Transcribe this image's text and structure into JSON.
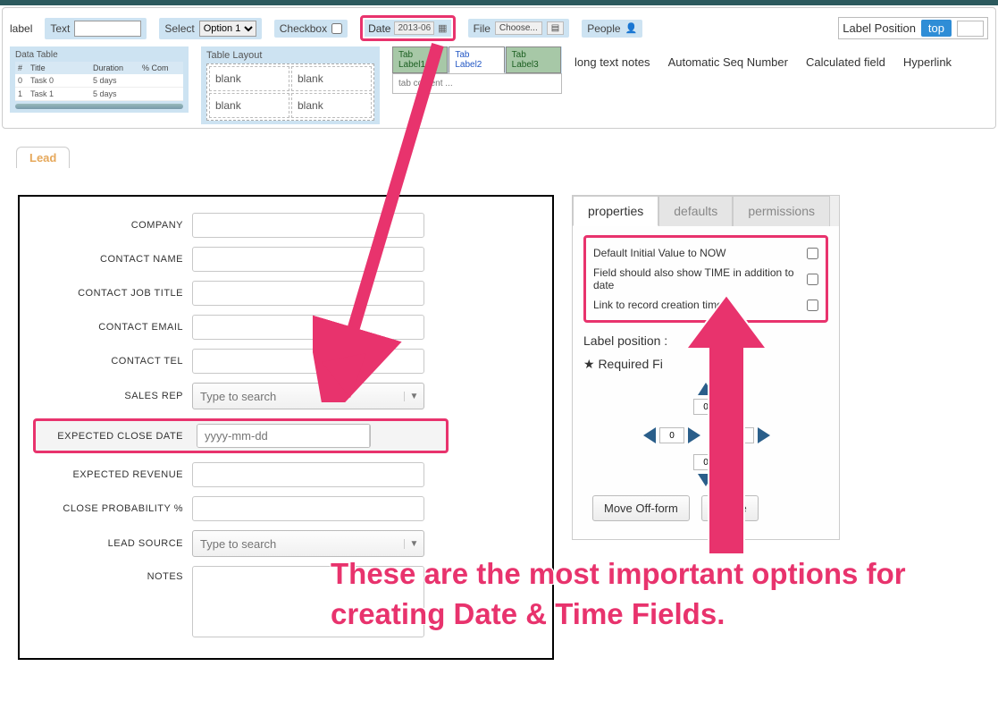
{
  "palette": {
    "label": "label",
    "text": "Text",
    "select": "Select",
    "select_option": "Option 1",
    "checkbox": "Checkbox",
    "date": "Date",
    "date_value": "2013-06",
    "file": "File",
    "file_button": "Choose...",
    "people": "People",
    "label_position": "Label Position",
    "label_position_value": "top"
  },
  "palette2": {
    "data_table": "Data Table",
    "dt_cols": {
      "num": "#",
      "title": "Title",
      "duration": "Duration",
      "pct": "% Com"
    },
    "dt_rows": [
      {
        "n": "0",
        "title": "Task 0",
        "dur": "5 days",
        "pct": ""
      },
      {
        "n": "1",
        "title": "Task 1",
        "dur": "5 days",
        "pct": ""
      }
    ],
    "table_layout": "Table Layout",
    "blank": "blank",
    "tabs": [
      "Tab Label1",
      "Tab Label2",
      "Tab Label3"
    ],
    "tab_content": "tab content ...",
    "links": [
      "long text notes",
      "Automatic Seq Number",
      "Calculated field",
      "Hyperlink"
    ]
  },
  "form": {
    "tab": "Lead",
    "fields": {
      "company": "COMPANY",
      "contact_name": "CONTACT NAME",
      "contact_job": "CONTACT JOB TITLE",
      "contact_email": "CONTACT EMAIL",
      "contact_tel": "CONTACT TEL",
      "sales_rep": "SALES REP",
      "sales_rep_ph": "Type to search",
      "expected_close": "EXPECTED CLOSE DATE",
      "date_ph": "yyyy-mm-dd",
      "expected_revenue": "EXPECTED REVENUE",
      "close_prob": "CLOSE PROBABILITY %",
      "lead_source": "LEAD SOURCE",
      "lead_source_ph": "Type to search",
      "notes": "NOTES"
    }
  },
  "props": {
    "tabs": [
      "properties",
      "defaults",
      "permissions"
    ],
    "opt1": "Default Initial Value to NOW",
    "opt2": "Field should also show TIME in addition to date",
    "opt3": "Link to record creation time",
    "label_position": "Label position :",
    "required": "★ Required Fi",
    "pad_vals": {
      "top": "0",
      "left": "0",
      "right": "0",
      "bottom": "0"
    },
    "move_off": "Move Off-form",
    "delete": "Delete"
  },
  "annotation": "These are the most important options for creating Date & Time Fields."
}
